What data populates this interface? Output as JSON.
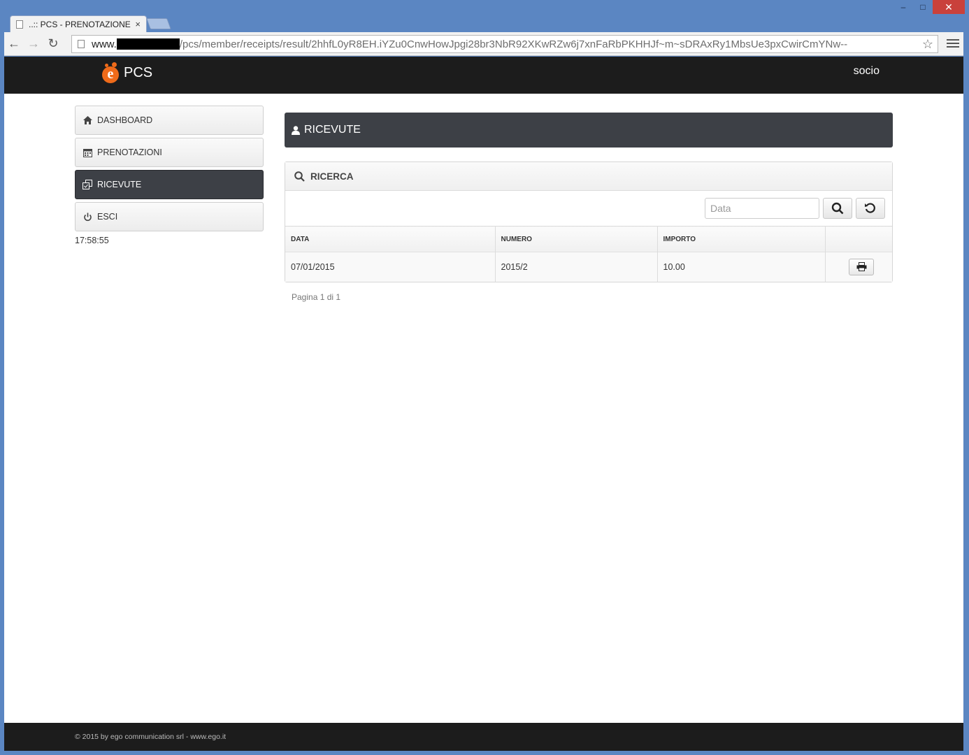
{
  "window": {
    "minimize": "–",
    "maximize": "□",
    "close": "✕"
  },
  "browser": {
    "tab_title": "..:: PCS - PRENOTAZIONE",
    "tab_close": "×",
    "url_host": "www.",
    "url_path": "/pcs/member/receipts/result/2hhfL0yR8EH.iYZu0CnwHowJpgi28br3NbR92XKwRZw6j7xnFaRbPKHHJf~m~sDRAxRy1MbsUe3pxCwirCmYNw--",
    "back": "←",
    "forward": "→",
    "reload": "↻",
    "star": "☆"
  },
  "header": {
    "brand": "PCS",
    "brand_logo_letter": "e",
    "user": "socio"
  },
  "sidebar": {
    "items": [
      {
        "label": "DASHBOARD",
        "icon": "home-icon"
      },
      {
        "label": "PRENOTAZIONI",
        "icon": "calendar-icon"
      },
      {
        "label": "RICEVUTE",
        "icon": "receipts-icon",
        "active": true
      },
      {
        "label": "ESCI",
        "icon": "power-icon"
      }
    ],
    "clock": "17:58:55"
  },
  "main": {
    "title": "RICEVUTE",
    "search": {
      "title": "RICERCA",
      "date_placeholder": "Data",
      "date_value": ""
    },
    "table": {
      "columns": [
        "DATA",
        "NUMERO",
        "IMPORTO",
        ""
      ],
      "rows": [
        {
          "data": "07/01/2015",
          "numero": "2015/2",
          "importo": "10.00"
        }
      ]
    },
    "pager": "Pagina 1 di 1"
  },
  "footer": {
    "text": "© 2015 by ego communication srl - www.ego.it"
  },
  "colors": {
    "topbar": "#1c1c1c",
    "header_panel": "#3d4046",
    "brand_accent": "#ef6b1a",
    "window_frame": "#5b86c2"
  }
}
